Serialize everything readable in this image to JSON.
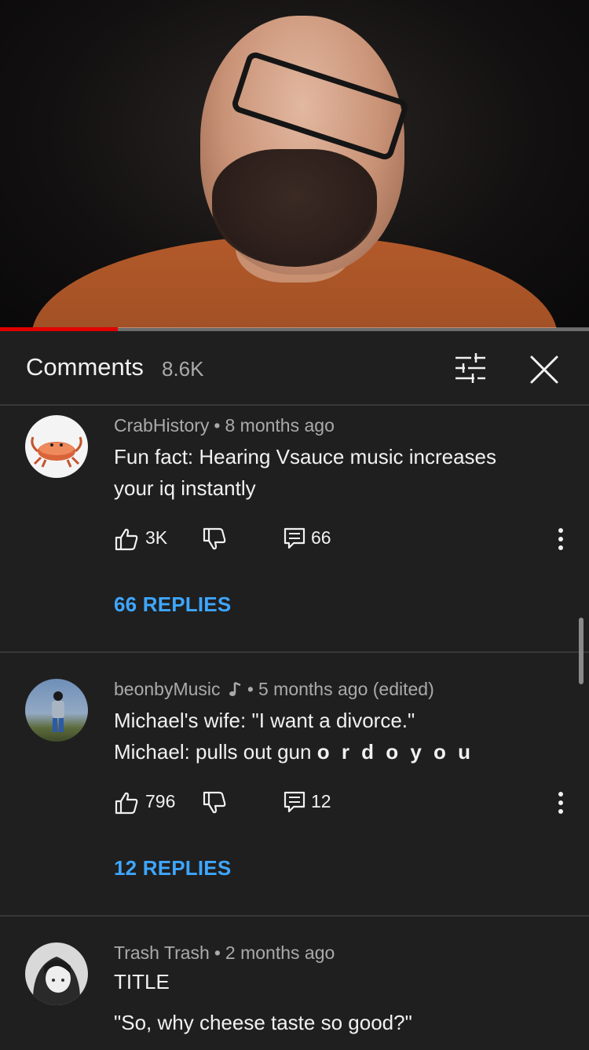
{
  "video": {
    "progress_percent": 20
  },
  "header": {
    "title": "Comments",
    "count": "8.6K",
    "sort_icon": "sort-filter-icon",
    "close_icon": "close-icon"
  },
  "comments": [
    {
      "author": "CrabHistory",
      "time": "8 months ago",
      "text_line1": "Fun fact: Hearing Vsauce music increases",
      "text_line2": "your iq instantly",
      "likes": "3K",
      "reply_count": "66",
      "replies_label": "66 REPLIES"
    },
    {
      "author": "beonbyMusic",
      "author_badge": "music-note-icon",
      "time": "5 months ago (edited)",
      "text_line1": "Michael's wife: \"I want a divorce.\"",
      "text_line2_prefix": "Michael: pulls out gun ",
      "text_line2_bold": "o r d o y o u",
      "likes": "796",
      "reply_count": "12",
      "replies_label": "12 REPLIES"
    },
    {
      "author": "Trash Trash",
      "time": "2 months ago",
      "text_line1": "TITLE",
      "text_line2": "\"So, why cheese taste so good?\""
    }
  ],
  "colors": {
    "background": "#1f1f1f",
    "accent_link": "#3ea6ff",
    "progress": "#e00000",
    "secondary_text": "#aaaaaa"
  }
}
